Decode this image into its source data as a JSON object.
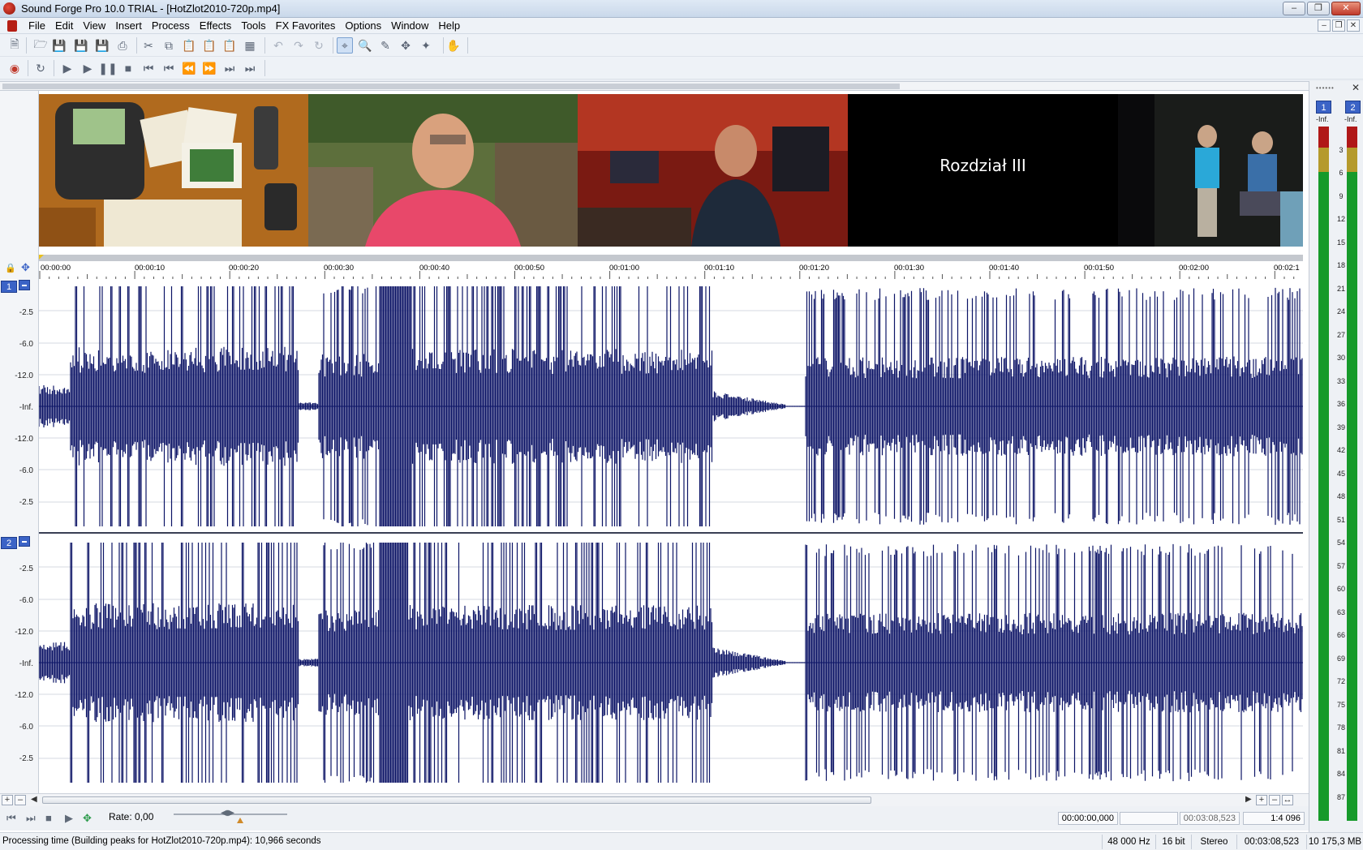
{
  "window": {
    "title": "Sound Forge Pro 10.0 TRIAL - [HotZlot2010-720p.mp4]"
  },
  "menu": [
    "File",
    "Edit",
    "View",
    "Insert",
    "Process",
    "Effects",
    "Tools",
    "FX Favorites",
    "Options",
    "Window",
    "Help"
  ],
  "video": {
    "chapter_text": "Rozdział III"
  },
  "ruler": {
    "time_labels": [
      "00:00:00",
      "00:00:10",
      "00:00:20",
      "00:00:30",
      "00:00:40",
      "00:00:50",
      "00:01:00",
      "00:01:10",
      "00:01:20",
      "00:01:30",
      "00:01:40",
      "00:01:50",
      "00:02:00",
      "00:02:1"
    ]
  },
  "tracks": [
    {
      "label": "1",
      "db_labels": [
        "-2.5",
        "-6.0",
        "-12.0",
        "-Inf.",
        "-12.0",
        "-6.0",
        "-2.5"
      ]
    },
    {
      "label": "2",
      "db_labels": [
        "-2.5",
        "-6.0",
        "-12.0",
        "-Inf.",
        "-12.0",
        "-6.0",
        "-2.5"
      ]
    }
  ],
  "transport": {
    "rate_label": "Rate: 0,00",
    "selection_start": "00:00:00,000",
    "selection_length": "",
    "total_length": "00:03:08,523",
    "zoom_ratio": "1:4 096"
  },
  "status": {
    "message": "Processing time (Building peaks for HotZlot2010-720p.mp4): 10,966 seconds",
    "sample_rate": "48 000 Hz",
    "bit_depth": "16 bit",
    "channels": "Stereo",
    "length": "00:03:08,523",
    "file_size": "10 175,3 MB"
  },
  "meters": {
    "channels": [
      "1",
      "2"
    ],
    "peak_labels": [
      "-Inf.",
      "-Inf."
    ],
    "scale": [
      "3",
      "6",
      "9",
      "12",
      "15",
      "18",
      "21",
      "24",
      "27",
      "30",
      "33",
      "36",
      "39",
      "42",
      "45",
      "48",
      "51",
      "54",
      "57",
      "60",
      "63",
      "66",
      "69",
      "72",
      "75",
      "78",
      "81",
      "84",
      "87"
    ]
  },
  "colors": {
    "waveform": "#0c1466",
    "meter_green": "#169a2a",
    "meter_red": "#b01818",
    "channel_badge": "#3b63c6"
  }
}
